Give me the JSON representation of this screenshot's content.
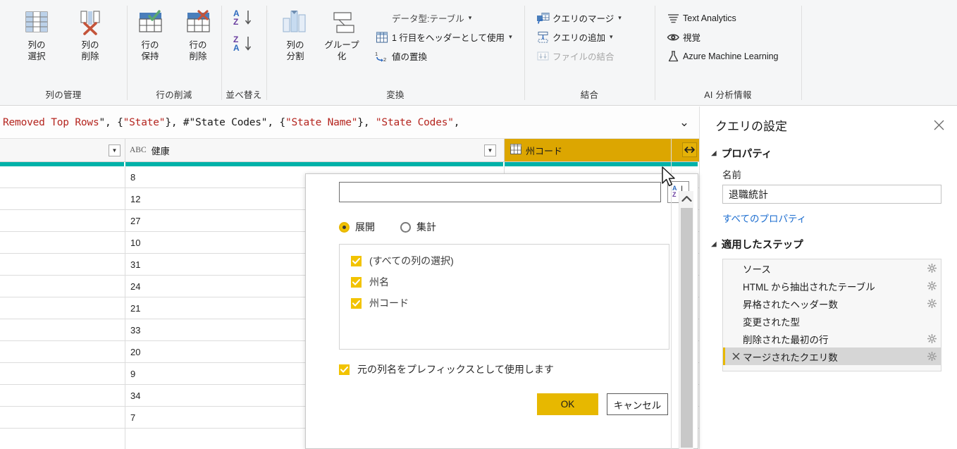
{
  "ribbon": {
    "groups": [
      {
        "label": "列の管理",
        "buttons": [
          {
            "label": "列の\n選択",
            "icon": "choose-columns-icon",
            "caret": true
          },
          {
            "label": "列の\n削除",
            "icon": "remove-columns-icon",
            "caret": true
          }
        ]
      },
      {
        "label": "行の削減",
        "buttons": [
          {
            "label": "行の\n保持",
            "icon": "keep-rows-icon",
            "caret": true
          },
          {
            "label": "行の\n削除",
            "icon": "remove-rows-icon",
            "caret": true
          }
        ]
      },
      {
        "label": "並べ替え",
        "buttons": [
          {
            "label": "",
            "icon": "sort-ascending-icon",
            "caret": false
          },
          {
            "label": "",
            "icon": "sort-descending-icon",
            "caret": false
          }
        ]
      },
      {
        "label": "変換",
        "buttons": [
          {
            "label": "列の\n分割",
            "icon": "split-column-icon",
            "caret": true
          },
          {
            "label": "グループ\n化",
            "icon": "group-by-icon",
            "caret": false
          }
        ],
        "small_items": [
          {
            "label": "データ型:テーブル",
            "icon": "data-type-icon",
            "caret": true,
            "disabled": false
          },
          {
            "label": "1 行目をヘッダーとして使用",
            "icon": "use-first-row-as-header-icon",
            "caret": true,
            "disabled": false
          },
          {
            "label": "値の置換",
            "icon": "replace-values-icon",
            "caret": false,
            "disabled": false
          }
        ]
      },
      {
        "label": "結合",
        "small_items": [
          {
            "label": "クエリのマージ",
            "icon": "merge-queries-icon",
            "caret": true,
            "disabled": false
          },
          {
            "label": "クエリの追加",
            "icon": "append-queries-icon",
            "caret": true,
            "disabled": false
          },
          {
            "label": "ファイルの結合",
            "icon": "combine-files-icon",
            "caret": false,
            "disabled": true
          }
        ]
      },
      {
        "label": "AI 分析情報",
        "small_items": [
          {
            "label": "Text Analytics",
            "icon": "text-analytics-icon",
            "caret": false,
            "disabled": false
          },
          {
            "label": "視覚",
            "icon": "vision-eye-icon",
            "caret": false,
            "disabled": false
          },
          {
            "label": "Azure Machine Learning",
            "icon": "azure-ml-flask-icon",
            "caret": false,
            "disabled": false
          }
        ]
      }
    ]
  },
  "formula_bar": {
    "segments": [
      {
        "text": "Removed Top Rows",
        "kind": "string"
      },
      {
        "text": "\", {",
        "kind": "plain"
      },
      {
        "text": "\"State\"",
        "kind": "string"
      },
      {
        "text": "}, #",
        "kind": "plain"
      },
      {
        "text": "\"State Codes\"",
        "kind": "plain"
      },
      {
        "text": ", {",
        "kind": "plain"
      },
      {
        "text": "\"State Name\"",
        "kind": "string"
      },
      {
        "text": "}, ",
        "kind": "plain"
      },
      {
        "text": "\"State Codes\"",
        "kind": "string"
      },
      {
        "text": ",",
        "kind": "plain"
      }
    ],
    "full_text": "Removed Top Rows\", {\"State\"}, #\"State Codes\", {\"State Name\"}, \"State Codes\",",
    "expand_icon": "chevron-down-icon"
  },
  "grid": {
    "columns": [
      {
        "name": "",
        "type_icon": "",
        "selected": false,
        "has_filter": true
      },
      {
        "name": "健康",
        "type_icon": "ABC",
        "selected": false,
        "has_filter": true
      },
      {
        "name": "州コード",
        "type_icon": "table-icon",
        "selected": true,
        "has_filter": true,
        "expand_icon": "expand-columns-icon"
      }
    ],
    "rows": [
      {
        "c0": "",
        "c1": "8",
        "c2": ""
      },
      {
        "c0": "",
        "c1": "12",
        "c2": ""
      },
      {
        "c0": "",
        "c1": "27",
        "c2": ""
      },
      {
        "c0": "",
        "c1": "10",
        "c2": ""
      },
      {
        "c0": "",
        "c1": "31",
        "c2": ""
      },
      {
        "c0": "",
        "c1": "24",
        "c2": ""
      },
      {
        "c0": "",
        "c1": "21",
        "c2": ""
      },
      {
        "c0": "",
        "c1": "33",
        "c2": ""
      },
      {
        "c0": "",
        "c1": "20",
        "c2": ""
      },
      {
        "c0": "",
        "c1": "9",
        "c2": ""
      },
      {
        "c0": "",
        "c1": "34",
        "c2": ""
      },
      {
        "c0": "",
        "c1": "7",
        "c2": ""
      },
      {
        "c0": "",
        "c1": "",
        "c2": ""
      }
    ]
  },
  "expand_dialog": {
    "search_value": "",
    "search_placeholder": "",
    "sort_button_icon": "sort-az-icon",
    "mode_options": [
      {
        "label": "展開",
        "selected": true
      },
      {
        "label": "集計",
        "selected": false
      }
    ],
    "column_items": [
      {
        "label": "(すべての列の選択)",
        "checked": true
      },
      {
        "label": "州名",
        "checked": true
      },
      {
        "label": "州コード",
        "checked": true
      }
    ],
    "prefix_option": {
      "label": "元の列名をプレフィックスとして使用します",
      "checked": true
    },
    "ok_label": "OK",
    "cancel_label": "キャンセル",
    "scroll_up_icon": "chevron-up-icon"
  },
  "query_settings": {
    "title": "クエリの設定",
    "close_icon": "close-icon",
    "properties": {
      "section_label": "プロパティ",
      "name_label": "名前",
      "name_value": "退職統計",
      "all_properties_link": "すべてのプロパティ"
    },
    "applied_steps": {
      "section_label": "適用したステップ",
      "steps": [
        {
          "name": "ソース",
          "gear": true,
          "active": false,
          "deletable": false
        },
        {
          "name": "HTML から抽出されたテーブル",
          "gear": true,
          "active": false,
          "deletable": false
        },
        {
          "name": "昇格されたヘッダー数",
          "gear": true,
          "active": false,
          "deletable": false
        },
        {
          "name": "変更された型",
          "gear": false,
          "active": false,
          "deletable": false
        },
        {
          "name": "削除された最初の行",
          "gear": true,
          "active": false,
          "deletable": false
        },
        {
          "name": "マージされたクエリ数",
          "gear": true,
          "active": true,
          "deletable": true
        }
      ]
    }
  },
  "colors": {
    "accent_gold": "#e7b800",
    "selected_column": "#dca601",
    "quality_bar_teal": "#00b2a9",
    "link_blue": "#1f6fd0",
    "ribbon_bg": "#f5f6f7",
    "string_literal_red": "#b5251f"
  }
}
